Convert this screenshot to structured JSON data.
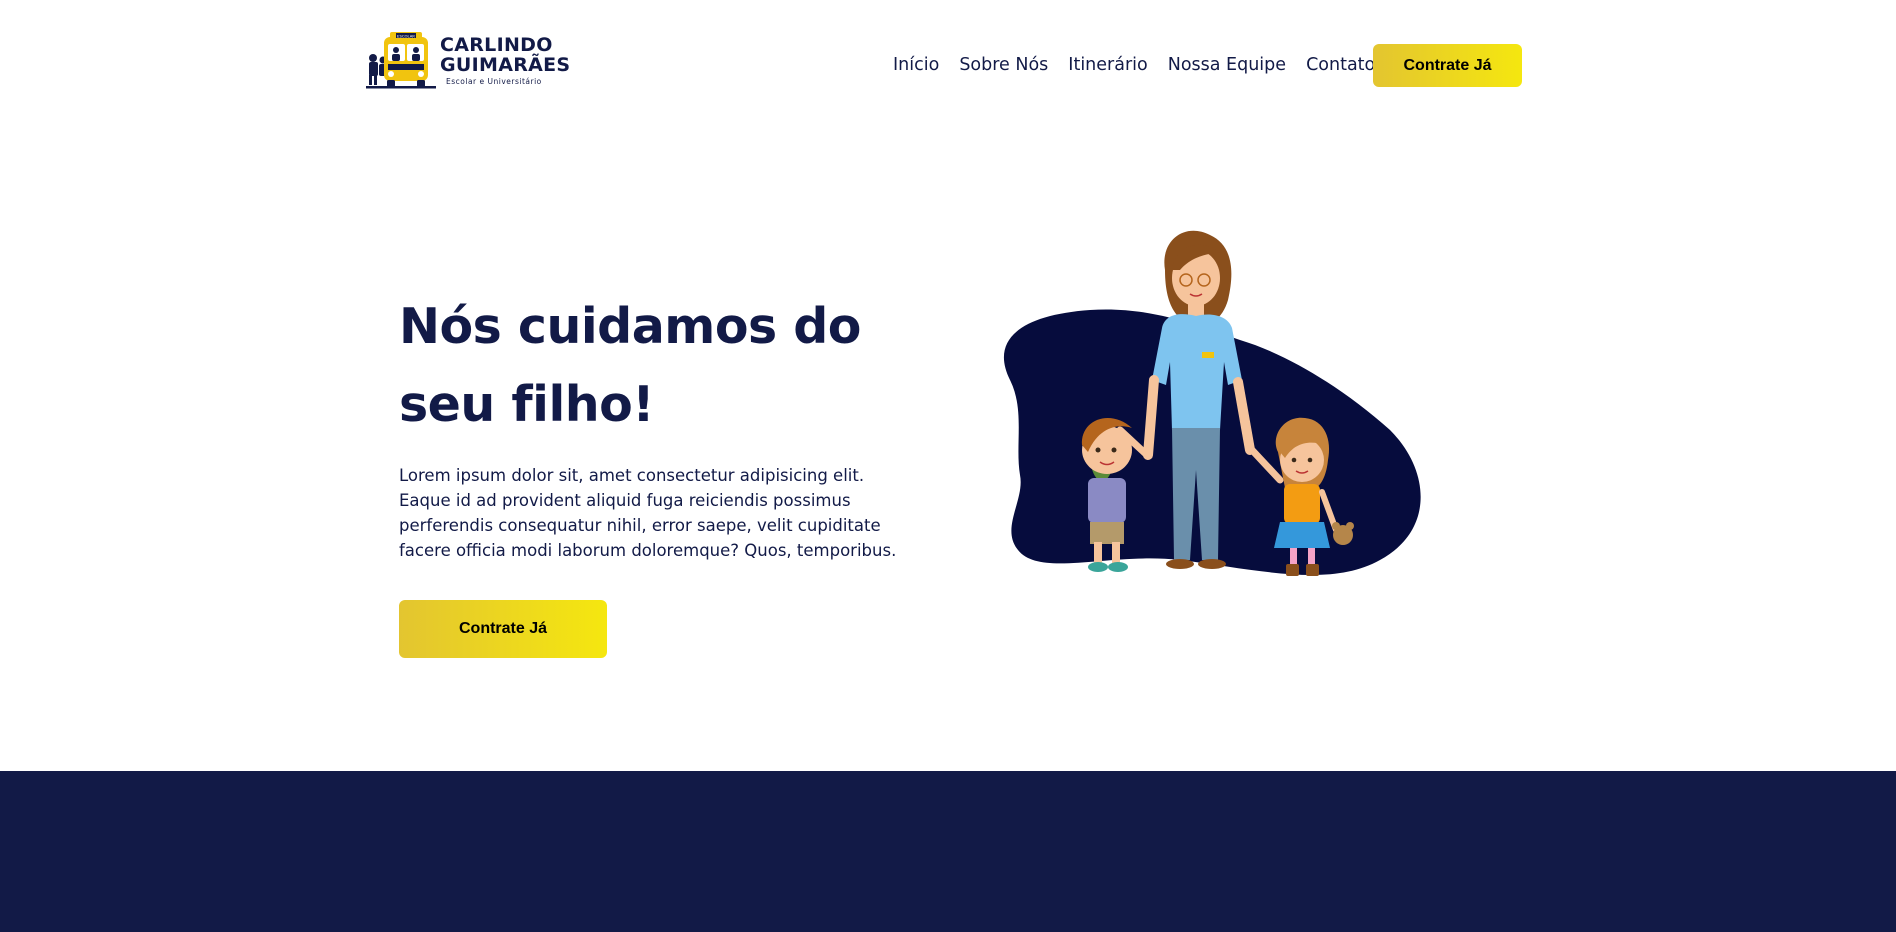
{
  "brand": {
    "name_line1": "CARLINDO",
    "name_line2": "GUIMARÃES",
    "tagline": "Escolar e Universitário",
    "bus_sign": "ESCOLAR"
  },
  "nav": {
    "items": [
      {
        "label": "Início"
      },
      {
        "label": "Sobre Nós"
      },
      {
        "label": "Itinerário"
      },
      {
        "label": "Nossa Equipe"
      },
      {
        "label": "Contato"
      }
    ],
    "cta_label": "Contrate Já"
  },
  "hero": {
    "title_line1": "Nós cuidamos do",
    "title_line2": "seu filho!",
    "text": "Lorem ipsum dolor sit, amet consectetur adipisicing elit. Eaque id ad provident aliquid fuga reiciendis possimus perferendis consequatur nihil, error saepe, velit cupiditate facere officia modi laborum doloremque? Quos, temporibus.",
    "cta_label": "Contrate Já"
  },
  "colors": {
    "navy": "#121a47",
    "accent_start": "#e3c530",
    "accent_end": "#f5e70f",
    "blob": "#060c3d"
  },
  "icons": {
    "logo": "school-bus-logo-icon",
    "illustration": "teacher-with-children-illustration"
  }
}
